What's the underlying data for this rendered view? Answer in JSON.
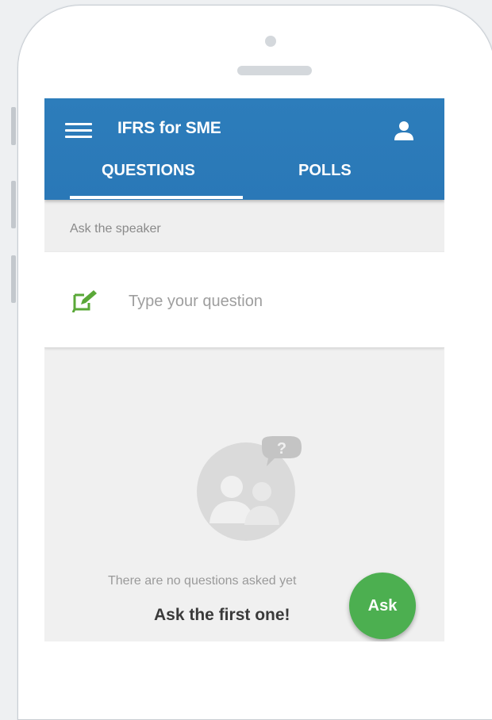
{
  "app": {
    "title": "IFRS for SME",
    "menu_icon": "hamburger-menu-icon",
    "profile_icon": "user-icon"
  },
  "tabs": [
    {
      "label": "QUESTIONS",
      "active": true
    },
    {
      "label": "POLLS",
      "active": false
    }
  ],
  "ask": {
    "section_label": "Ask the speaker",
    "input_placeholder": "Type your question",
    "input_icon": "edit-icon"
  },
  "empty_state": {
    "illustration_icon": "people-question-icon",
    "message": "There are no questions asked yet",
    "cta": "Ask the first one!"
  },
  "fab": {
    "label": "Ask"
  },
  "colors": {
    "app_bar": "#2d7dbb",
    "fab": "#4caf50",
    "input_icon": "#5aa838"
  }
}
